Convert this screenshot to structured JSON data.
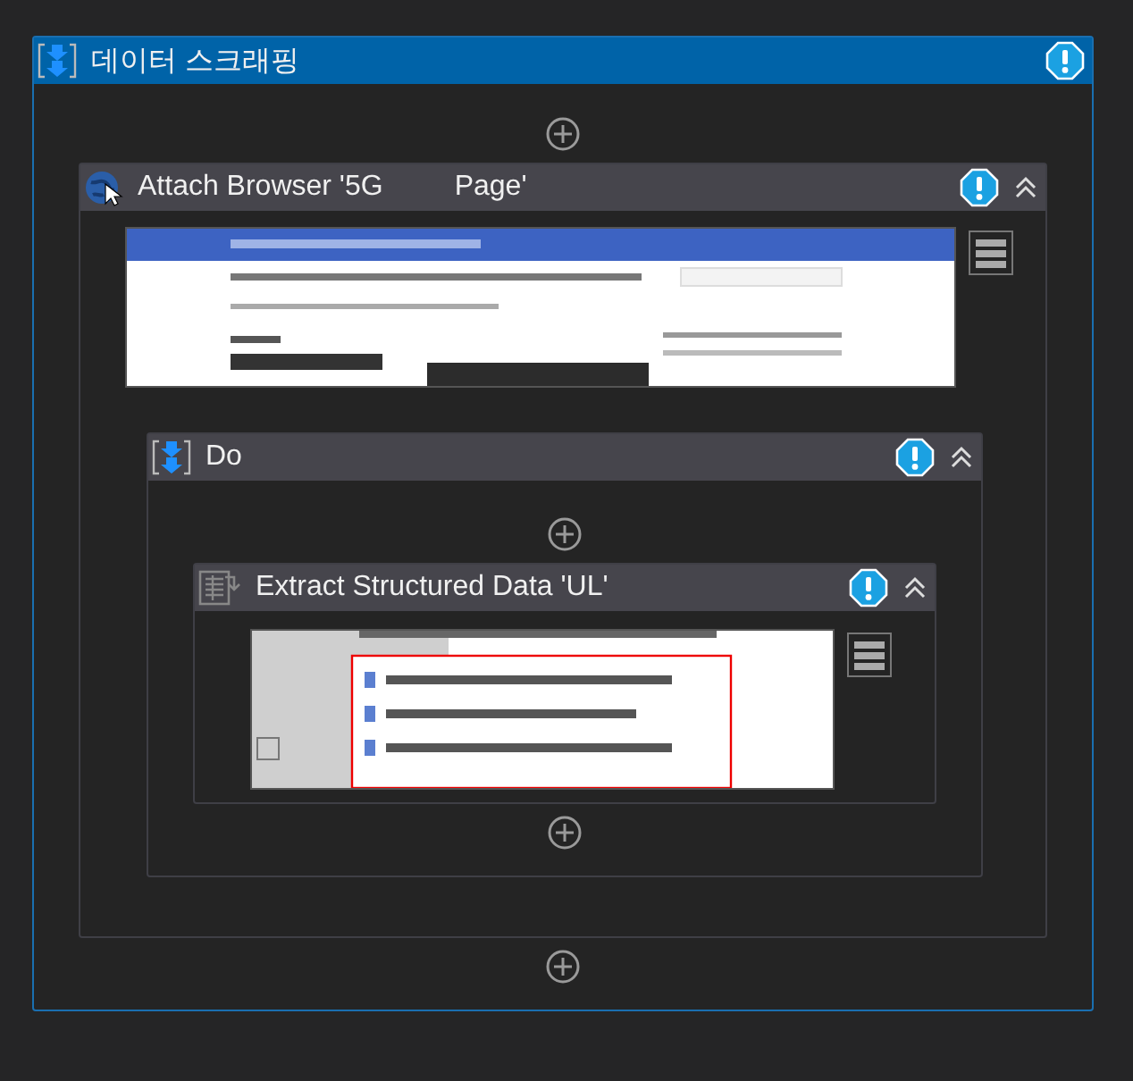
{
  "sequence": {
    "kind": "sequence",
    "title": "데이터 스크래핑",
    "warning": true,
    "selected": true,
    "children": [
      {
        "kind": "attach",
        "title": "Attach Browser '5G         Page'",
        "warning": true,
        "expanded": true,
        "children": [
          {
            "kind": "sequence",
            "title": "Do",
            "warning": true,
            "expanded": true,
            "selected": false,
            "children": [
              {
                "kind": "extract",
                "title": "Extract Structured Data 'UL'",
                "warning": true,
                "expanded": true
              }
            ]
          }
        ]
      }
    ]
  }
}
